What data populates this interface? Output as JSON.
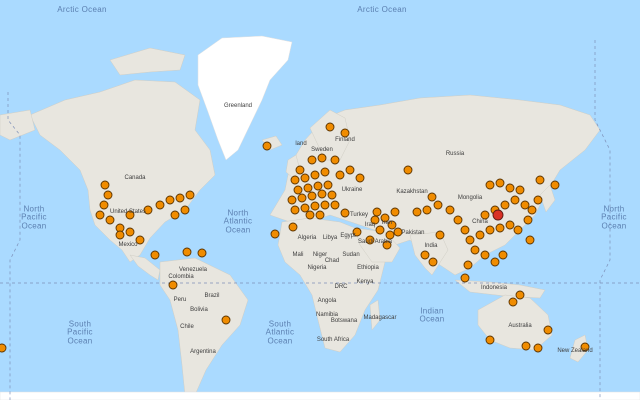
{
  "oceans": [
    {
      "id": "arctic-ocean-1",
      "text": "Arctic Ocean"
    },
    {
      "id": "arctic-ocean-2",
      "text": "Arctic Ocean"
    },
    {
      "id": "north-atlantic",
      "text": "North\nAtlantic\nOcean"
    },
    {
      "id": "north-pacific-west",
      "text": "North\nPacific\nOcean"
    },
    {
      "id": "north-pacific-east",
      "text": "North\nPacific\nOcean"
    },
    {
      "id": "south-pacific",
      "text": "South\nPacific\nOcean"
    },
    {
      "id": "south-atlantic",
      "text": "South\nAtlantic\nOcean"
    },
    {
      "id": "indian-ocean",
      "text": "Indian\nOcean"
    }
  ],
  "countries": [
    "Greenland",
    "Canada",
    "United States",
    "Mexico",
    "Venezuela",
    "Colombia",
    "Peru",
    "Brazil",
    "Bolivia",
    "Chile",
    "Argentina",
    "Sweden",
    "Finland",
    "Russia",
    "Ukraine",
    "Kazakhstan",
    "Mongolia",
    "Turkey",
    "Iran",
    "Iraq",
    "Saudi Arabia",
    "Pakistan",
    "India",
    "China",
    "Algeria",
    "Libya",
    "Egypt",
    "Mali",
    "Niger",
    "Chad",
    "Sudan",
    "Nigeria",
    "Ethiopia",
    "Kenya",
    "DRC",
    "Angola",
    "Namibia",
    "Botswana",
    "South Africa",
    "Madagascar",
    "Indonesia",
    "Australia",
    "New Zealand",
    "land"
  ],
  "marker_style": {
    "fill": "#f08c00",
    "highlight": "#d93025",
    "stroke": "#5a3300"
  }
}
